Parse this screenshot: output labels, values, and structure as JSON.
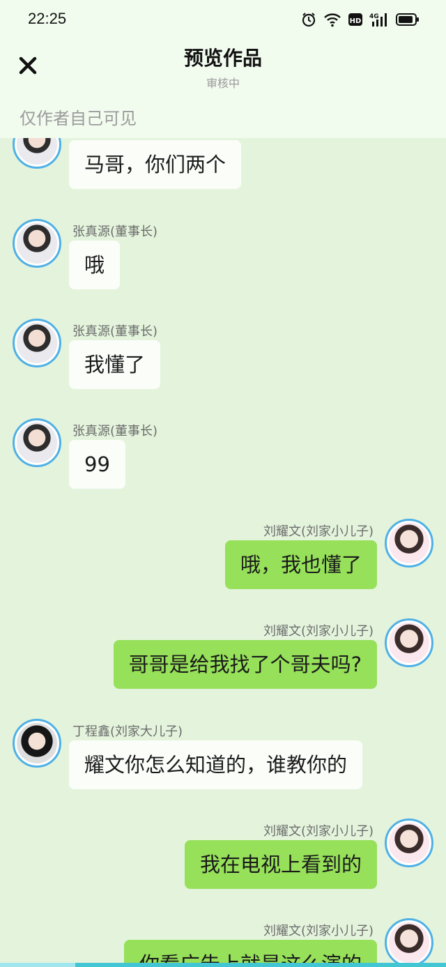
{
  "status_bar": {
    "time": "22:25",
    "icons": [
      "alarm-icon",
      "wifi-icon",
      "hd-icon",
      "signal-4g-icon",
      "battery-icon"
    ]
  },
  "header": {
    "title": "预览作品",
    "subtitle": "审核中",
    "visibility": "仅作者自己可见"
  },
  "messages": [
    {
      "side": "left",
      "name": "",
      "text": "马哥，你们两个"
    },
    {
      "side": "left",
      "name": "张真源(董事长)",
      "text": "哦"
    },
    {
      "side": "left",
      "name": "张真源(董事长)",
      "text": "我懂了"
    },
    {
      "side": "left",
      "name": "张真源(董事长)",
      "text": "99"
    },
    {
      "side": "right",
      "name": "刘耀文(刘家小儿子)",
      "text": "哦，我也懂了"
    },
    {
      "side": "right",
      "name": "刘耀文(刘家小儿子)",
      "text": "哥哥是给我找了个哥夫吗?"
    },
    {
      "side": "left",
      "name": "丁程鑫(刘家大儿子)",
      "text": "耀文你怎么知道的，谁教你的"
    },
    {
      "side": "right",
      "name": "刘耀文(刘家小儿子)",
      "text": "我在电视上看到的"
    },
    {
      "side": "right",
      "name": "刘耀文(刘家小儿子)",
      "text": "你看广告上就是这么演的"
    }
  ],
  "colors": {
    "background": "#e4f4dc",
    "header": "#f1fbee",
    "bubble_right": "#96e05a",
    "bubble_left": "#fbfdf9",
    "avatar_ring": "#4fb0e6"
  }
}
